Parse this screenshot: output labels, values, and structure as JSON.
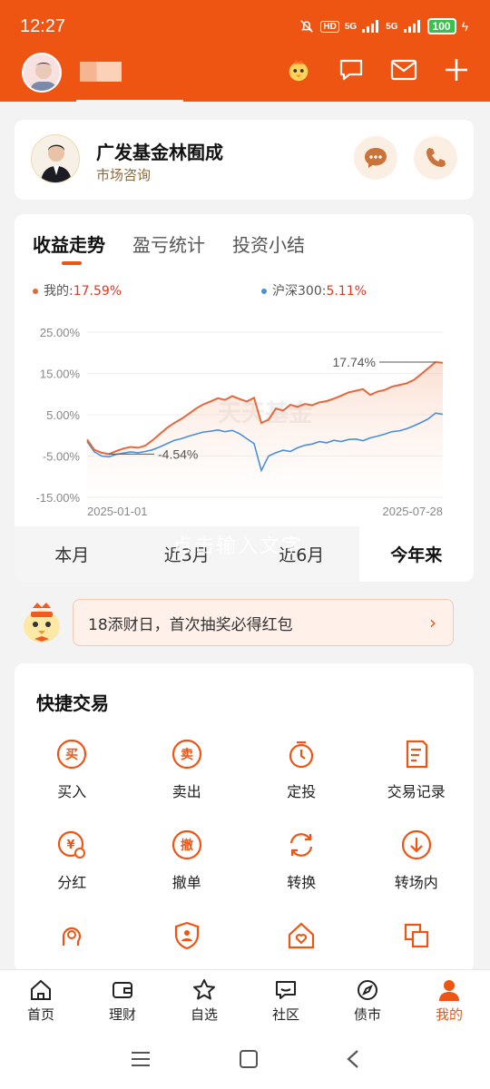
{
  "status_bar": {
    "time": "12:27",
    "signal1": "5G",
    "signal2": "5G",
    "hd": "HD",
    "battery": "100"
  },
  "header": {
    "icons": [
      "mascot-icon",
      "chat-icon",
      "mail-icon",
      "plus-icon"
    ]
  },
  "advisor": {
    "name": "广发基金林囿成",
    "role": "市场咨询"
  },
  "chart_card": {
    "tabs": [
      "收益走势",
      "盈亏统计",
      "投资小结"
    ],
    "legend_mine_label": "我的:",
    "legend_mine_value": "17.59%",
    "legend_index_label": "沪深300:",
    "legend_index_value": "5.11%",
    "overlay_hint": "点击输入文字",
    "watermark": "天天基金",
    "periods": [
      "本月",
      "近3月",
      "近6月",
      "今年来"
    ],
    "active_period": "今年来"
  },
  "chart_data": {
    "type": "line",
    "y_ticks": [
      "25.00%",
      "15.00%",
      "5.00%",
      "-5.00%",
      "-15.00%"
    ],
    "ylim": [
      -15,
      25
    ],
    "x_labels": [
      "2025-01-01",
      "2025-07-28"
    ],
    "annotation_max": "17.74%",
    "annotation_min": "-4.54%",
    "colors": {
      "mine": "#e8663a",
      "index": "#4a90d9"
    },
    "series": [
      {
        "name": "我的",
        "values": [
          -1,
          -3.5,
          -4.2,
          -4.54,
          -3.8,
          -3.2,
          -2.8,
          -3.0,
          -2.5,
          -1.2,
          0.3,
          1.8,
          3.0,
          4.0,
          5.2,
          6.5,
          7.5,
          8.2,
          9.0,
          8.6,
          9.5,
          8.8,
          8.2,
          9.1,
          3.0,
          3.8,
          6.5,
          6.0,
          7.4,
          6.9,
          7.6,
          7.3,
          8.0,
          8.3,
          8.9,
          9.6,
          10.4,
          10.8,
          11.2,
          9.8,
          10.6,
          11.0,
          11.8,
          12.2,
          12.6,
          13.4,
          14.8,
          16.3,
          17.74,
          17.59
        ]
      },
      {
        "name": "沪深300",
        "values": [
          -1.5,
          -4.0,
          -5.0,
          -5.2,
          -4.6,
          -4.3,
          -4.0,
          -4.2,
          -3.9,
          -3.5,
          -2.8,
          -2.0,
          -1.2,
          -0.8,
          -0.2,
          0.3,
          0.8,
          1.0,
          1.3,
          0.9,
          1.2,
          0.4,
          -0.8,
          -2.0,
          -8.5,
          -5.0,
          -4.2,
          -3.6,
          -3.9,
          -3.0,
          -2.4,
          -2.1,
          -1.5,
          -1.8,
          -1.2,
          -1.5,
          -1.0,
          -0.9,
          -1.3,
          -0.6,
          -0.2,
          0.3,
          0.9,
          1.1,
          1.6,
          2.3,
          3.1,
          4.0,
          5.4,
          5.11
        ]
      }
    ]
  },
  "promo": {
    "text": "18添财日，首次抽奖必得红包"
  },
  "quick_trade": {
    "title": "快捷交易",
    "items": [
      {
        "label": "买入",
        "icon": "buy-icon"
      },
      {
        "label": "卖出",
        "icon": "sell-icon"
      },
      {
        "label": "定投",
        "icon": "timer-icon"
      },
      {
        "label": "交易记录",
        "icon": "record-icon"
      },
      {
        "label": "分红",
        "icon": "dividend-icon"
      },
      {
        "label": "撤单",
        "icon": "cancel-order-icon"
      },
      {
        "label": "转换",
        "icon": "convert-icon"
      },
      {
        "label": "转场内",
        "icon": "transfer-in-icon"
      }
    ]
  },
  "bottom_nav": [
    {
      "label": "首页",
      "icon": "home-icon"
    },
    {
      "label": "理财",
      "icon": "wallet-icon"
    },
    {
      "label": "自选",
      "icon": "star-icon"
    },
    {
      "label": "社区",
      "icon": "community-icon"
    },
    {
      "label": "债市",
      "icon": "compass-icon"
    },
    {
      "label": "我的",
      "icon": "profile-icon"
    }
  ],
  "brand_color": "#ee5513"
}
